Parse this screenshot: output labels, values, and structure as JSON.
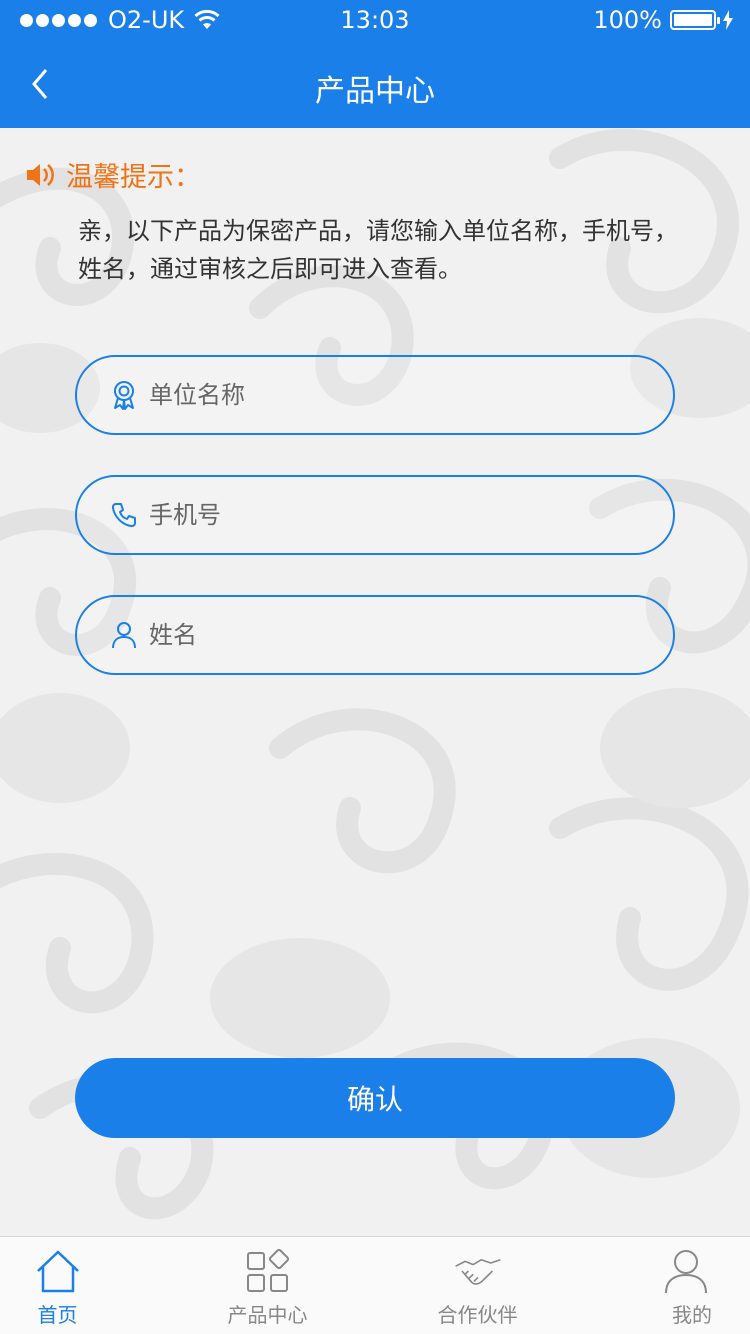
{
  "status_bar": {
    "carrier": "O2-UK",
    "time": "13:03",
    "battery": "100%",
    "battery_level": 1.0
  },
  "nav": {
    "title": "产品中心"
  },
  "notice": {
    "title": "温馨提示：",
    "body": "亲，以下产品为保密产品，请您输入单位名称，手机号，姓名，通过审核之后即可进入查看。"
  },
  "form": {
    "company": {
      "placeholder": "单位名称",
      "icon": "award-icon"
    },
    "phone": {
      "placeholder": "手机号",
      "icon": "phone-icon"
    },
    "name": {
      "placeholder": "姓名",
      "icon": "user-icon"
    },
    "confirm_label": "确认"
  },
  "tabbar": {
    "items": [
      {
        "label": "首页",
        "icon": "home-icon",
        "active": true
      },
      {
        "label": "产品中心",
        "icon": "grid-icon",
        "active": false
      },
      {
        "label": "合作伙伴",
        "icon": "handshake-icon",
        "active": false
      },
      {
        "label": "我的",
        "icon": "profile-icon",
        "active": false
      }
    ]
  },
  "colors": {
    "primary": "#1a7fe8",
    "accent": "#f07318",
    "background": "#f1f1f1"
  }
}
